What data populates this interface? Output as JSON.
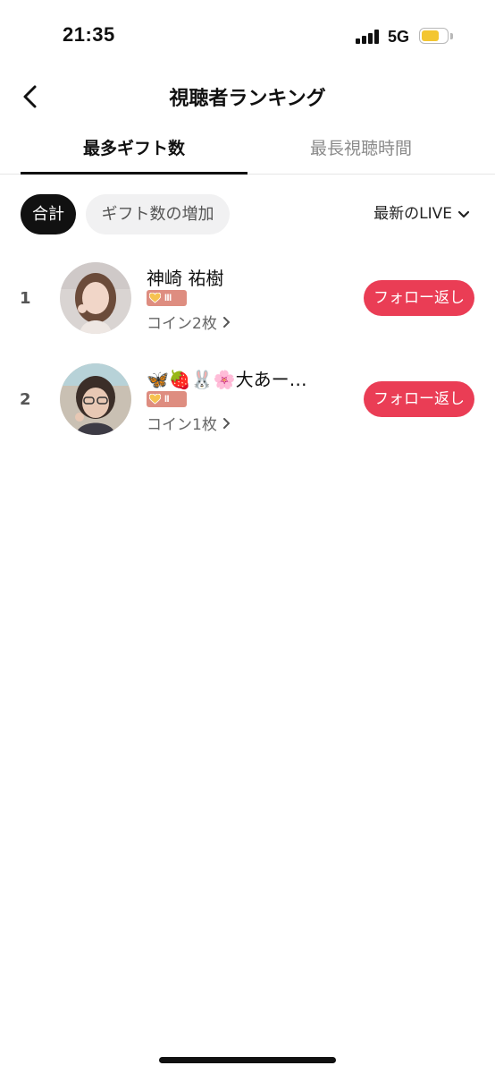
{
  "status_bar": {
    "time": "21:35",
    "network": "5G",
    "battery_level": 0.6,
    "battery_color": "#f3c631"
  },
  "header": {
    "title": "視聴者ランキング",
    "back_icon": "chevron-left-icon"
  },
  "tabs": [
    {
      "label": "最多ギフト数",
      "active": true
    },
    {
      "label": "最長視聴時間",
      "active": false
    }
  ],
  "filters": {
    "chips": [
      {
        "label": "合計",
        "selected": true
      },
      {
        "label": "ギフト数の増加",
        "selected": false
      }
    ],
    "dropdown": {
      "label": "最新のLIVE",
      "icon": "chevron-down-icon"
    }
  },
  "ranking": [
    {
      "rank": "1",
      "name": "神崎 祐樹",
      "badge_level": "III",
      "coins": "コイン2枚",
      "action": "フォロー返し"
    },
    {
      "rank": "2",
      "name": "🦋🍓🐰🌸大あー…",
      "badge_level": "II",
      "coins": "コイン1枚",
      "action": "フォロー返し"
    }
  ],
  "colors": {
    "accent": "#ea3d55",
    "badge": "#de8d80",
    "chip_selected": "#111111",
    "chip_unselected": "#f1f1f2"
  }
}
